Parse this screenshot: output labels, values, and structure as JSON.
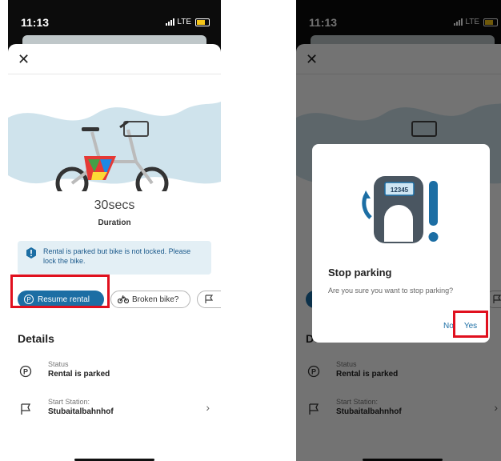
{
  "status_bar": {
    "time": "11:13",
    "network": "LTE"
  },
  "rental": {
    "duration_value": "30secs",
    "duration_label": "Duration",
    "notice": "Rental is parked but bike is not locked. Please lock the bike.",
    "actions": {
      "resume": "Resume rental",
      "broken": "Broken bike?"
    }
  },
  "details": {
    "title": "Details",
    "status_label": "Status",
    "status_value": "Rental is parked",
    "station_label": "Start Station:",
    "station_value": "Stubaitalbahnhof"
  },
  "dialog": {
    "lock_code": "12345",
    "title": "Stop parking",
    "message": "Are you sure you want to stop parking?",
    "no": "No",
    "yes": "Yes"
  },
  "colors": {
    "primary": "#1c6ea4",
    "notice_bg": "#e3eff5",
    "highlight": "#e0101e",
    "hero_bg": "#cfe3ec"
  },
  "icons": [
    "close-icon",
    "parking-icon",
    "flag-icon",
    "info-icon",
    "broken-bike-icon",
    "chevron-right-icon",
    "lock-icon"
  ]
}
